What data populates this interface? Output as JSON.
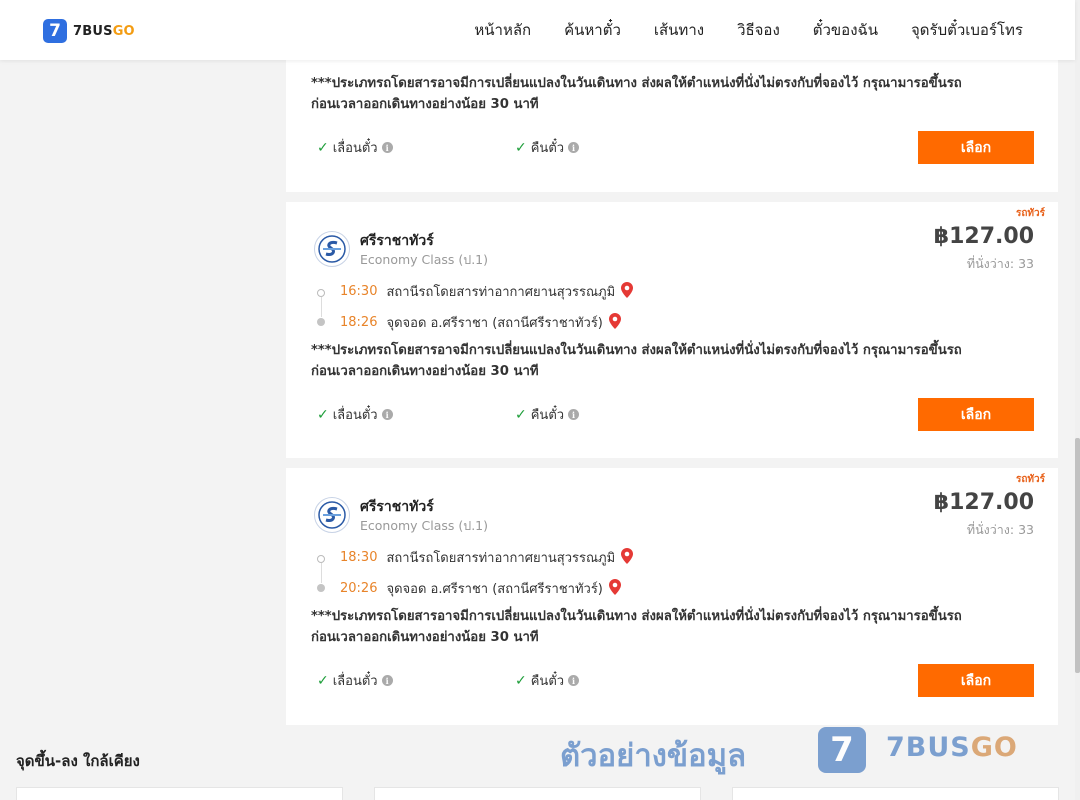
{
  "header": {
    "logo_mark": "7",
    "logo_text_a": "7BUS",
    "logo_text_b": "GO",
    "nav": [
      "หน้าหลัก",
      "ค้นหาตั๋ว",
      "เส้นทาง",
      "วิธีจอง",
      "ตั๋วของฉัน",
      "จุดรับตั๋วเบอร์โทร"
    ]
  },
  "common": {
    "note_line1": "***ประเภทรถโดยสารอาจมีการเปลี่ยนแปลงในวันเดินทาง ส่งผลให้ตำแหน่งที่นั่งไม่ตรงกับที่จองไว้ กรุณามารอขึ้นรถ",
    "note_line2": "ก่อนเวลาออกเดินทางอย่างน้อย 30 นาที",
    "feature_change": "เลื่อนตั๋ว",
    "feature_refund": "คืนตั๋ว",
    "select_label": "เลือก",
    "badge": "รถทัวร์"
  },
  "trips": [
    {
      "operator": "ศรีราชาทัวร์",
      "class": "Economy Class (ป.1)",
      "price": "฿127.00",
      "seats": "ที่นั่งว่าง: 33",
      "depart_time": "16:30",
      "depart_place": "สถานีรถโดยสารท่าอากาศยานสุวรรณภูมิ",
      "arrive_time": "18:26",
      "arrive_place": "จุดจอด อ.ศรีราชา (สถานีศรีราชาทัวร์)"
    },
    {
      "operator": "ศรีราชาทัวร์",
      "class": "Economy Class (ป.1)",
      "price": "฿127.00",
      "seats": "ที่นั่งว่าง: 33",
      "depart_time": "18:30",
      "depart_place": "สถานีรถโดยสารท่าอากาศยานสุวรรณภูมิ",
      "arrive_time": "20:26",
      "arrive_place": "จุดจอด อ.ศรีราชา (สถานีศรีราชาทัวร์)"
    }
  ],
  "nearby": {
    "title": "จุดขึ้น-ลง ใกล้เคียง"
  },
  "watermark": {
    "text": "ตัวอย่างข้อมูล",
    "logo_mark": "7",
    "brand_a": "7BUS",
    "brand_b": "GO"
  },
  "icons": {
    "check": "check-icon",
    "info": "info-icon",
    "pin": "map-pin-icon",
    "operator_logo": "operator-logo-icon"
  },
  "colors": {
    "accent": "#ff6a00",
    "time": "#e8842a",
    "brand_blue": "#2f6fe0",
    "check": "#1e9e3a",
    "pin": "#e53935"
  }
}
